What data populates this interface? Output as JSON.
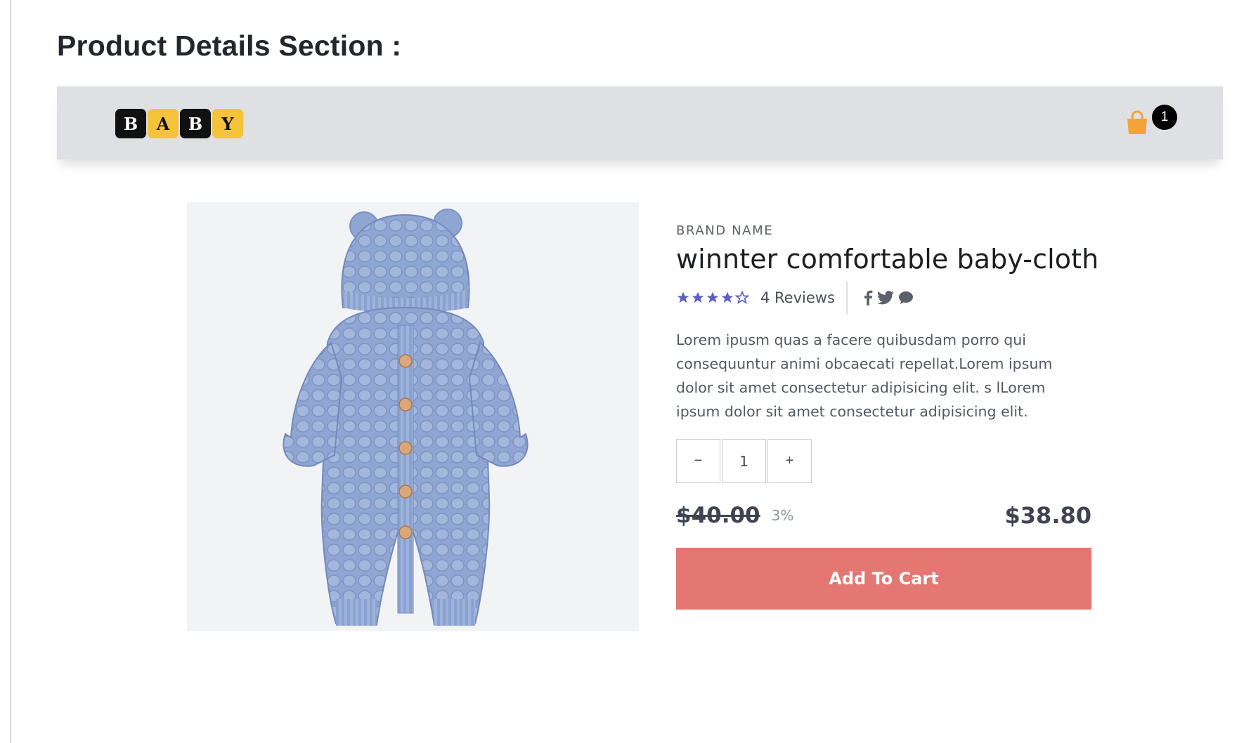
{
  "page": {
    "heading": "Product Details Section :"
  },
  "navbar": {
    "logo_letters": [
      "B",
      "A",
      "B",
      "Y"
    ],
    "cart_count": "1",
    "cart_icon": "shopping-bag-icon",
    "colors": {
      "background": "#dfe0e4",
      "cart": "#f2a33a",
      "logo_yellow": "#f5c33b"
    }
  },
  "product": {
    "image_alt": "Blue knitted hooded baby romper with wooden buttons",
    "brand": "BRAND NAME",
    "title": "winnter comfortable baby-cloth",
    "rating": 4,
    "rating_max": 5,
    "reviews_label": "4 Reviews",
    "social_icons": [
      "facebook-icon",
      "twitter-icon",
      "chat-icon"
    ],
    "description": "Lorem ipusm quas a facere quibusdam porro qui consequuntur animi obcaecati repellat.Lorem ipsum dolor sit amet consectetur adipisicing elit. s lLorem ipsum dolor sit amet consectetur adipisicing elit.",
    "quantity": {
      "decrement_label": "−",
      "value": "1",
      "increment_label": "+"
    },
    "old_price": "$40.00",
    "discount": "3%",
    "price": "$38.80",
    "add_to_cart_label": "Add To Cart",
    "colors": {
      "star": "#5a5fc8",
      "button": "#e57773"
    }
  }
}
